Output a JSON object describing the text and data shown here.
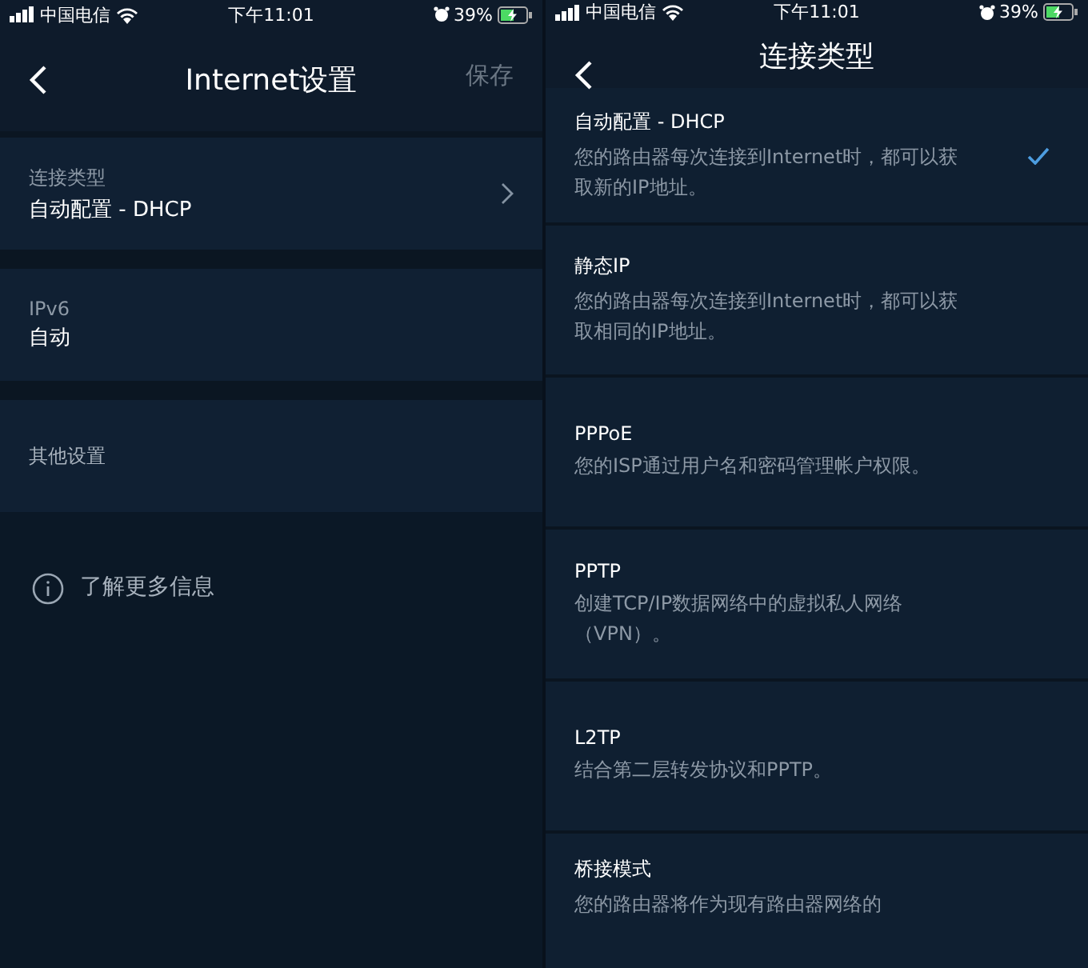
{
  "screens": [
    {
      "status_bar": {
        "carrier": "中国电信",
        "time": "下午11:01",
        "battery": "39%"
      },
      "header": {
        "title": "Internet设置",
        "action": "保存"
      },
      "settings": [
        {
          "kind": "nav",
          "label": "连接类型",
          "value": "自动配置 - DHCP"
        },
        {
          "kind": "value",
          "label": "IPv6",
          "value": "自动"
        },
        {
          "kind": "plain",
          "label": "其他设置"
        }
      ],
      "info_link": "了解更多信息"
    },
    {
      "status_bar": {
        "carrier": "中国电信",
        "time": "下午11:01",
        "battery": "39%"
      },
      "header": {
        "title": "连接类型"
      },
      "options": [
        {
          "title": "自动配置 - DHCP",
          "description": "您的路由器每次连接到Internet时，都可以获取新的IP地址。",
          "selected": true
        },
        {
          "title": "静态IP",
          "description": "您的路由器每次连接到Internet时，都可以获取相同的IP地址。",
          "selected": false
        },
        {
          "title": "PPPoE",
          "description": "您的ISP通过用户名和密码管理帐户权限。",
          "selected": false
        },
        {
          "title": "PPTP",
          "description": "创建TCP/IP数据网络中的虚拟私人网络（VPN）。",
          "selected": false
        },
        {
          "title": "L2TP",
          "description": "结合第二层转发协议和PPTP。",
          "selected": false
        },
        {
          "title": "桥接模式",
          "description": "您的路由器将作为现有路由器网络的",
          "selected": false
        }
      ]
    }
  ]
}
